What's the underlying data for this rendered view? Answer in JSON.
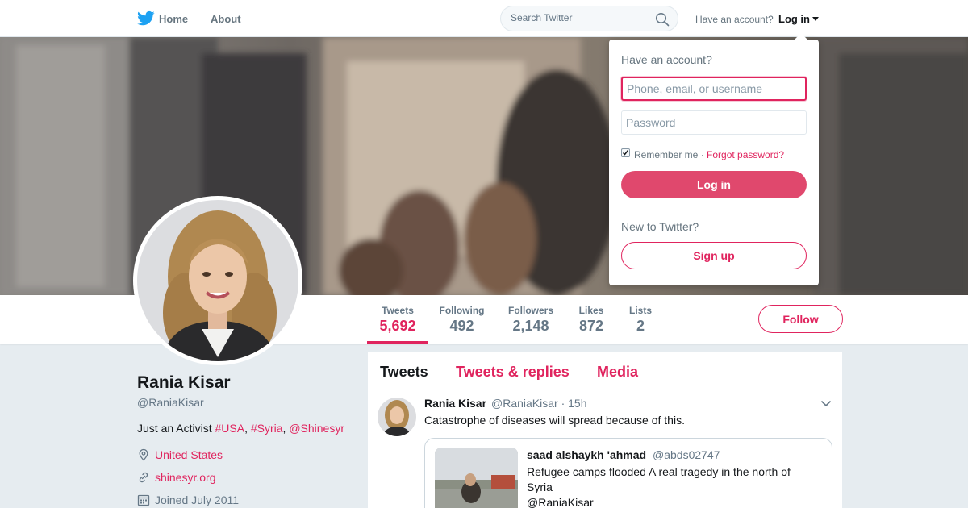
{
  "nav": {
    "home": "Home",
    "about": "About",
    "search_placeholder": "Search Twitter",
    "have_account": "Have an account?",
    "login": "Log in"
  },
  "profile": {
    "name": "Rania Kisar",
    "handle": "@RaniaKisar",
    "bio_text": "Just an Activist ",
    "bio_tag_usa": "#USA",
    "bio_sep1": ", ",
    "bio_tag_syria": "#Syria",
    "bio_sep2": ", ",
    "bio_mention": "@Shinesyr",
    "location": "United States",
    "website": "shinesyr.org",
    "joined": "Joined July 2011"
  },
  "stats": [
    {
      "label": "Tweets",
      "value": "5,692"
    },
    {
      "label": "Following",
      "value": "492"
    },
    {
      "label": "Followers",
      "value": "2,148"
    },
    {
      "label": "Likes",
      "value": "872"
    },
    {
      "label": "Lists",
      "value": "2"
    }
  ],
  "follow_label": "Follow",
  "timeline": {
    "tabs": [
      "Tweets",
      "Tweets & replies",
      "Media"
    ],
    "tweet": {
      "name": "Rania Kisar",
      "handle": "@RaniaKisar",
      "time": "· 15h",
      "text": "Catastrophe of diseases will spread because of this.",
      "quote": {
        "name": "saad alshaykh 'ahmad",
        "handle": "@abds02747",
        "text": "Refugee camps flooded A real tragedy in the north of Syria",
        "mention": "@RaniaKisar"
      }
    }
  },
  "login_dropdown": {
    "title": "Have an account?",
    "username_placeholder": "Phone, email, or username",
    "password_placeholder": "Password",
    "remember": "Remember me",
    "separator": " · ",
    "forgot": "Forgot password?",
    "login_button": "Log in",
    "new_to": "New to Twitter?",
    "signup_button": "Sign up"
  },
  "colors": {
    "accent": "#e0245e",
    "login_button": "#e0486d",
    "twitter_blue": "#1da1f2",
    "background": "#e6ecf0"
  }
}
